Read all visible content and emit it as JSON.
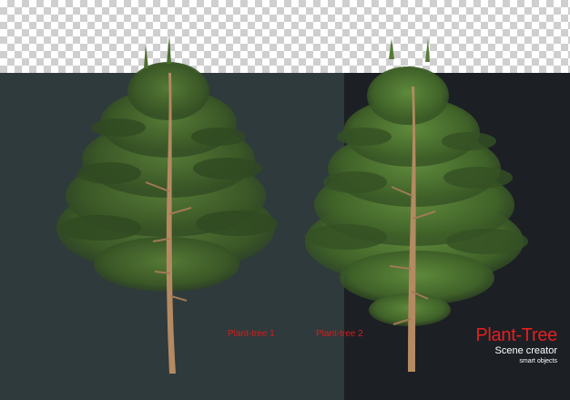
{
  "labels": {
    "tree1": "Plant-tree 1",
    "tree2": "Plant-tree 2"
  },
  "brand": {
    "title": "Plant-Tree",
    "subtitle": "Scene creator",
    "tagline": "smart objects"
  },
  "colors": {
    "panel_left": "#2f3a3c",
    "panel_right": "#1c1f24",
    "label_red": "#d21e1e",
    "foliage": "#3e5a2a",
    "trunk": "#b48a62"
  }
}
